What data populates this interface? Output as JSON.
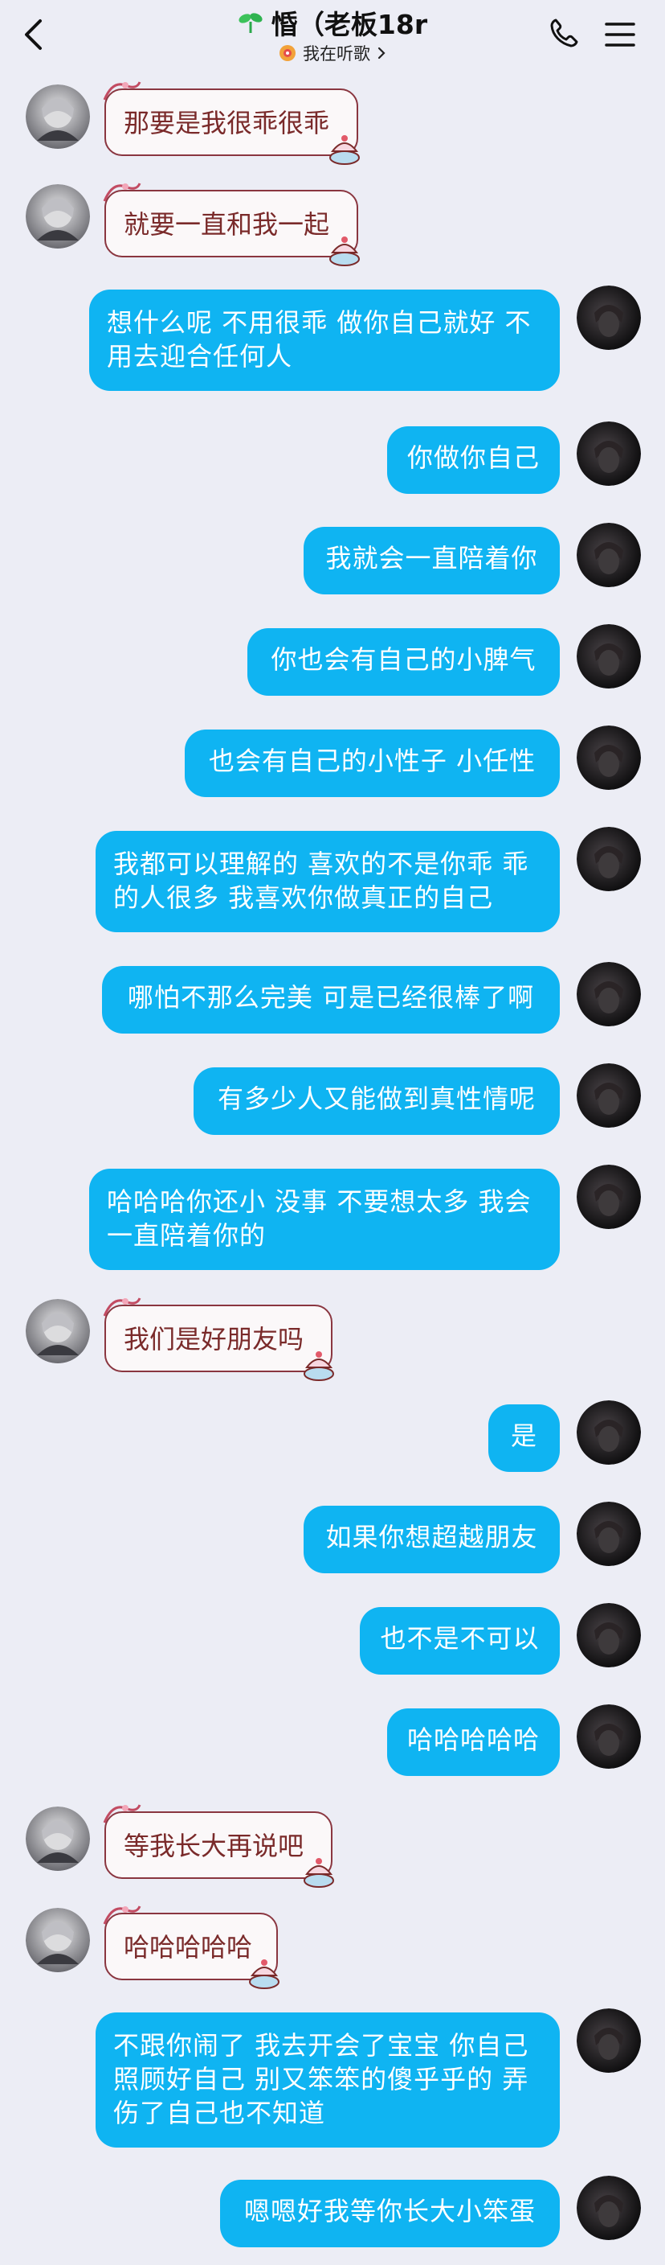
{
  "header": {
    "title": "惛（老板18r",
    "status": "我在听歌"
  },
  "colors": {
    "background": "#ecedf5",
    "my_bubble": "#0fb4f2",
    "their_bubble_border": "#8a3640",
    "their_text": "#7a2a2a"
  },
  "messages": [
    {
      "from": "them",
      "text": "那要是我很乖很乖"
    },
    {
      "from": "them",
      "text": "就要一直和我一起"
    },
    {
      "from": "me",
      "lines": [
        "想什么呢 不用很乖 做你自己就好 不",
        "用去迎合任何人"
      ]
    },
    {
      "from": "me",
      "text": "你做你自己"
    },
    {
      "from": "me",
      "text": "我就会一直陪着你"
    },
    {
      "from": "me",
      "text": "你也会有自己的小脾气"
    },
    {
      "from": "me",
      "text": "也会有自己的小性子 小任性"
    },
    {
      "from": "me",
      "lines": [
        "我都可以理解的 喜欢的不是你乖 乖",
        "的人很多 我喜欢你做真正的自己"
      ]
    },
    {
      "from": "me",
      "text": "哪怕不那么完美 可是已经很棒了啊"
    },
    {
      "from": "me",
      "text": "有多少人又能做到真性情呢"
    },
    {
      "from": "me",
      "lines": [
        "哈哈哈你还小 没事 不要想太多 我会",
        "一直陪着你的"
      ]
    },
    {
      "from": "them",
      "text": "我们是好朋友吗"
    },
    {
      "from": "me",
      "text": "是"
    },
    {
      "from": "me",
      "text": "如果你想超越朋友"
    },
    {
      "from": "me",
      "text": "也不是不可以"
    },
    {
      "from": "me",
      "text": "哈哈哈哈哈"
    },
    {
      "from": "them",
      "text": "等我长大再说吧"
    },
    {
      "from": "them",
      "text": "哈哈哈哈哈"
    },
    {
      "from": "me",
      "lines": [
        "不跟你闹了 我去开会了宝宝 你自己",
        "照顾好自己 别又笨笨的傻乎乎的 弄",
        "伤了自己也不知道"
      ]
    },
    {
      "from": "me",
      "text": "嗯嗯好我等你长大小笨蛋"
    }
  ]
}
